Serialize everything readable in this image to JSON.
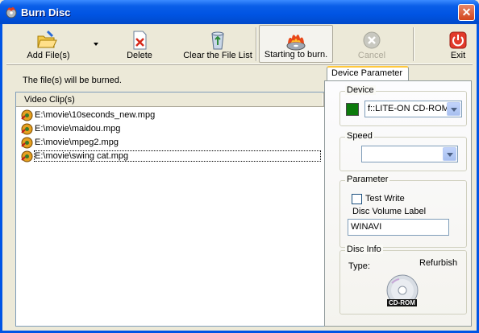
{
  "window": {
    "title": "Burn Disc",
    "close_glyph": "✕"
  },
  "toolbar": {
    "buttons": [
      {
        "label": "Add File(s)",
        "icon": "folder-open-icon"
      },
      {
        "label": "Delete",
        "icon": "delete-document-icon"
      },
      {
        "label": "Clear the File List",
        "icon": "recycle-bin-icon"
      },
      {
        "label": "Starting to burn.",
        "icon": "burning-disc-icon"
      },
      {
        "label": "Cancel",
        "icon": "cancel-icon"
      },
      {
        "label": "Exit",
        "icon": "power-icon"
      }
    ]
  },
  "main": {
    "note": "The file(s) will be burned.",
    "list_header": "Video Clip(s)",
    "files": [
      "E:\\movie\\10seconds_new.mpg",
      "E:\\movie\\maidou.mpg",
      "E:\\movie\\mpeg2.mpg",
      "E:\\movie\\swing cat.mpg"
    ]
  },
  "side": {
    "tab": "Device Parameter",
    "device": {
      "title": "Device",
      "value": "f::LITE-ON CD-ROM"
    },
    "speed": {
      "title": "Speed",
      "value": ""
    },
    "parameter": {
      "title": "Parameter",
      "test_write": "Test Write",
      "volume_label": "Disc Volume Label",
      "volume_value": "WINAVI"
    },
    "disc_info": {
      "title": "Disc Info",
      "type_label": "Type:",
      "type_value": "Refurbish",
      "disc_text": "CD-ROM"
    }
  },
  "colors": {
    "titlebar": "#0054E3",
    "face": "#ECE9D8",
    "device_swatch": "#0C7A0C"
  }
}
